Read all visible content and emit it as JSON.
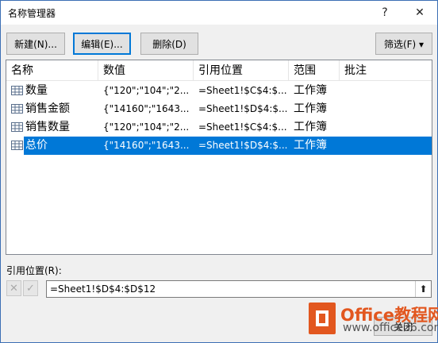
{
  "window": {
    "title": "名称管理器",
    "help": "?",
    "close": "✕"
  },
  "toolbar": {
    "new_label": "新建(N)...",
    "edit_label": "编辑(E)...",
    "delete_label": "删除(D)",
    "filter_label": "筛选(F) ▾"
  },
  "list": {
    "columns": [
      "名称",
      "数值",
      "引用位置",
      "范围",
      "批注"
    ],
    "rows": [
      {
        "name": "数量",
        "value": "{\"120\";\"104\";\"2...",
        "ref": "=Sheet1!$C$4:$...",
        "scope": "工作簿",
        "selected": false
      },
      {
        "name": "销售金额",
        "value": "{\"14160\";\"1643...",
        "ref": "=Sheet1!$D$4:$...",
        "scope": "工作簿",
        "selected": false
      },
      {
        "name": "销售数量",
        "value": "{\"120\";\"104\";\"2...",
        "ref": "=Sheet1!$C$4:$...",
        "scope": "工作簿",
        "selected": false
      },
      {
        "name": "总价",
        "value": "{\"14160\";\"1643...",
        "ref": "=Sheet1!$D$4:$...",
        "scope": "工作簿",
        "selected": true
      }
    ]
  },
  "reference": {
    "label": "引用位置(R):",
    "value": "=Sheet1!$D$4:$D$12",
    "collapse": "⬆"
  },
  "footer": {
    "close_label": "关闭"
  },
  "watermark": {
    "title": "Office教程网",
    "url": "www.office26.com"
  },
  "colors": {
    "selection": "#0078d7",
    "logo": "#e2571f"
  }
}
